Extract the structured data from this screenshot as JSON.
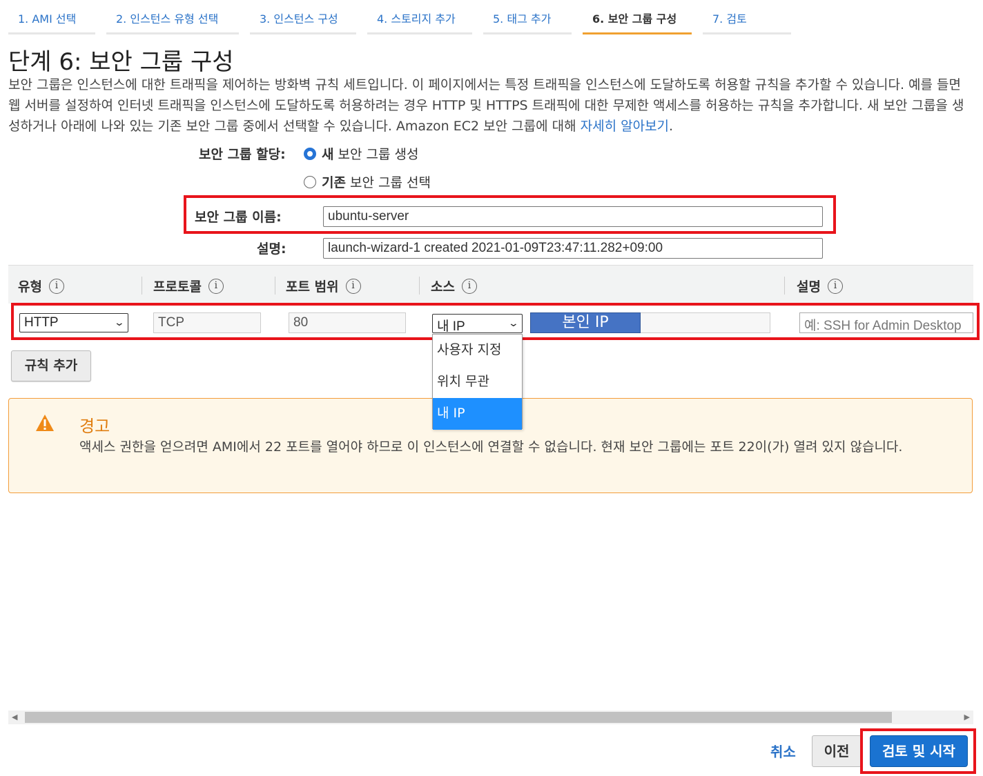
{
  "steps": [
    {
      "label": "1. AMI 선택"
    },
    {
      "label": "2. 인스턴스 유형 선택"
    },
    {
      "label": "3. 인스턴스 구성"
    },
    {
      "label": "4. 스토리지 추가"
    },
    {
      "label": "5. 태그 추가"
    },
    {
      "label": "6. 보안 그룹 구성"
    },
    {
      "label": "7. 검토"
    }
  ],
  "active_step": "6. 보안 그룹 구성",
  "page": {
    "title": "단계 6: 보안 그룹 구성",
    "intro": "보안 그룹은 인스턴스에 대한 트래픽을 제어하는 방화벽 규칙 세트입니다. 이 페이지에서는 특정 트래픽을 인스턴스에 도달하도록 허용할 규칙을 추가할 수 있습니다. 예를 들면 웹 서버를 설정하여 인터넷 트래픽을 인스턴스에 도달하도록 허용하려는 경우 HTTP 및 HTTPS 트래픽에 대한 무제한 액세스를 허용하는 규칙을 추가합니다. 새 보안 그룹을 생성하거나 아래에 나와 있는 기존 보안 그룹 중에서 선택할 수 있습니다. Amazon EC2 보안 그룹에 대해",
    "learn_more": "자세히 알아보기",
    "period": "."
  },
  "assign": {
    "label": "보안 그룹 할당:",
    "opt_new_bold": "새",
    "opt_new_rest": "보안 그룹 생성",
    "opt_existing_bold": "기존",
    "opt_existing_rest": "보안 그룹 선택",
    "selected": "새 보안 그룹 생성"
  },
  "sg_name": {
    "label": "보안 그룹 이름:",
    "value": "ubuntu-server"
  },
  "sg_desc": {
    "label": "설명:",
    "value": "launch-wizard-1 created 2021-01-09T23:47:11.282+09:00"
  },
  "columns": {
    "type": "유형",
    "protocol": "프로토콜",
    "port": "포트 범위",
    "source": "소스",
    "description": "설명",
    "info_glyph": "i"
  },
  "rule": {
    "type": "HTTP",
    "protocol": "TCP",
    "port": "80",
    "source": "내 IP",
    "ip_value": "본인 IP",
    "desc_placeholder": "예: SSH for Admin Desktop"
  },
  "source_options": [
    "사용자 지정",
    "위치 무관",
    "내 IP"
  ],
  "source_selected": "내 IP",
  "add_rule": "규칙 추가",
  "warning": {
    "title": "경고",
    "text": "액세스 권한을 얻으려면 AMI에서 22 포트를 열어야 하므로 이 인스턴스에 연결할 수 없습니다. 현재 보안 그룹에는 포트 22이(가) 열려 있지 않습니다."
  },
  "footer": {
    "cancel": "취소",
    "previous": "이전",
    "review_launch": "검토 및 시작"
  },
  "colors": {
    "highlight": "#e8141b",
    "accent": "#2b73c8",
    "primary_button": "#1a73d1",
    "warning_border": "#f39c3a",
    "warning_bg": "#fef7e8",
    "ip_chip": "#4573c4",
    "dropdown_selected": "#1e90ff"
  },
  "icons": {
    "warning": "warning-triangle-icon",
    "info": "info-icon",
    "chevron": "chevron-down-icon",
    "scroll_left": "arrow-left-icon",
    "scroll_right": "arrow-right-icon"
  }
}
